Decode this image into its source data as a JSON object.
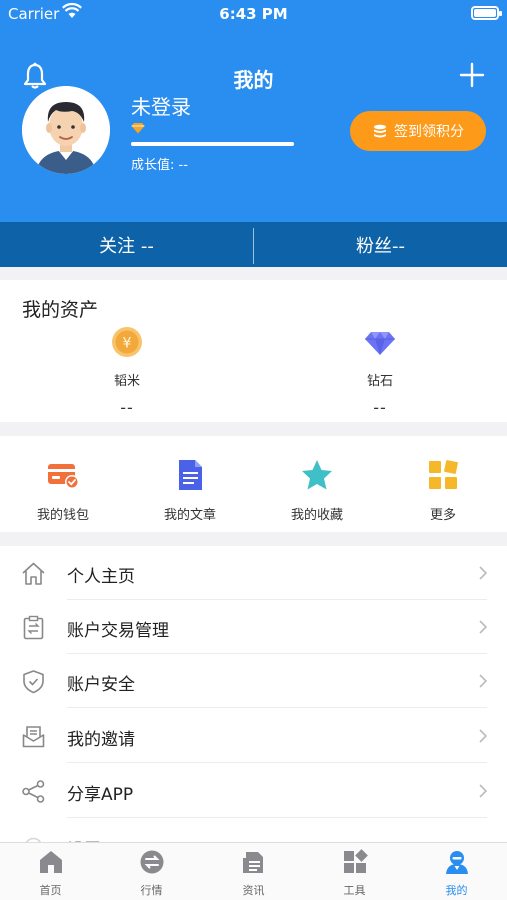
{
  "status_bar": {
    "carrier": "Carrier",
    "time": "6:43 PM"
  },
  "header": {
    "title": "我的",
    "username": "未登录",
    "growth_label": "成长值: --",
    "signin_label": "签到领积分",
    "progress": 1.0
  },
  "follow": {
    "following_label": "关注  --",
    "fans_label": "粉丝--"
  },
  "assets": {
    "title": "我的资产",
    "items": [
      {
        "label": "韬米",
        "value": "--",
        "icon": "yuan-coin-icon"
      },
      {
        "label": "钻石",
        "value": "--",
        "icon": "diamond-icon"
      }
    ]
  },
  "quick_actions": [
    {
      "label": "我的钱包",
      "icon": "wallet-icon"
    },
    {
      "label": "我的文章",
      "icon": "document-icon"
    },
    {
      "label": "我的收藏",
      "icon": "star-icon"
    },
    {
      "label": "更多",
      "icon": "grid-icon"
    }
  ],
  "menu": [
    {
      "label": "个人主页",
      "icon": "home-icon"
    },
    {
      "label": "账户交易管理",
      "icon": "transfer-clipboard-icon"
    },
    {
      "label": "账户安全",
      "icon": "shield-check-icon"
    },
    {
      "label": "我的邀请",
      "icon": "mail-icon"
    },
    {
      "label": "分享APP",
      "icon": "share-icon"
    },
    {
      "label": "设置",
      "icon": "settings-icon"
    }
  ],
  "tabs": [
    {
      "label": "首页",
      "icon": "home-tab-icon",
      "active": false
    },
    {
      "label": "行情",
      "icon": "exchange-tab-icon",
      "active": false
    },
    {
      "label": "资讯",
      "icon": "news-tab-icon",
      "active": false
    },
    {
      "label": "工具",
      "icon": "tools-tab-icon",
      "active": false
    },
    {
      "label": "我的",
      "icon": "profile-tab-icon",
      "active": true
    }
  ],
  "colors": {
    "header_blue": "#2a8df0",
    "follow_bar": "#0d62a8",
    "accent_orange": "#fd9a1a",
    "active_tab": "#2a8df0"
  }
}
